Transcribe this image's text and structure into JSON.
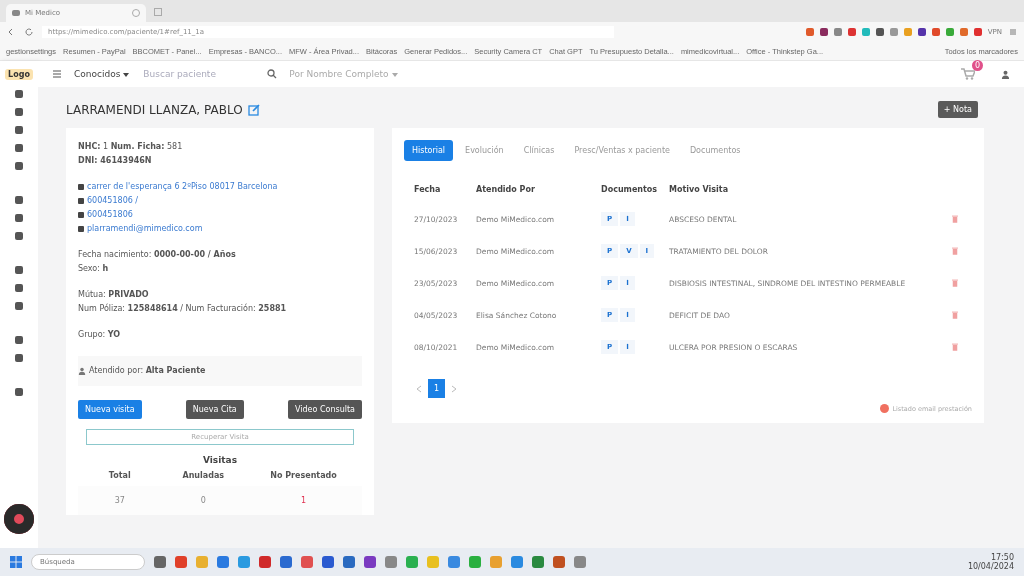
{
  "browser": {
    "tab_title": "Mi Medico",
    "url": "https://mimedico.com/paciente/1#ref_11_1a",
    "vpn": "VPN",
    "bookmarks": [
      "gestionsettings",
      "Resumen - PayPal",
      "BBCOMET - Panel...",
      "Empresas - BANCO...",
      "MFW - Área Privad...",
      "Bitácoras",
      "Generar Pedidos...",
      "Security Camera CT",
      "Chat GPT",
      "Tu Presupuesto Detalla...",
      "mimedicovirtual...",
      "Office - Thinkstep Ga..."
    ],
    "bookmarks_folder": "Todos los marcadores"
  },
  "topbar": {
    "logo": "Logo",
    "filter": "Conocidos",
    "search": {
      "placeholder": "Buscar paciente"
    },
    "search_mode": "Por Nombre Completo",
    "cart_count": "0"
  },
  "patient": {
    "name": "LARRAMENDI LLANZA, PABLO",
    "note_button": "+ Nota"
  },
  "info": {
    "lines": [
      {
        "kind": "text",
        "text": "**NHC:** 1  **Num. Ficha:** 581"
      },
      {
        "kind": "text",
        "text": "**DNI: 46143946N**"
      },
      {
        "kind": "gap"
      },
      {
        "kind": "link",
        "text": "carrer de l'esperança 6 2ºPiso 08017 Barcelona"
      },
      {
        "kind": "link",
        "text": "600451806 /"
      },
      {
        "kind": "link",
        "text": "600451806"
      },
      {
        "kind": "link",
        "text": "plarramendi@mimedico.com"
      },
      {
        "kind": "gap"
      },
      {
        "kind": "text",
        "text": "Fecha nacimiento: **0000-00-00 / Años**"
      },
      {
        "kind": "text",
        "text": "Sexo: **h**"
      },
      {
        "kind": "gap"
      },
      {
        "kind": "text",
        "text": "Mútua: **PRIVADO**"
      },
      {
        "kind": "text",
        "text": "Num Póliza: **125848614** / Num Facturación: **25881**"
      },
      {
        "kind": "gap"
      },
      {
        "kind": "text",
        "text": "Grupo: **YO**"
      }
    ],
    "attended": "Atendido por: **Alta Paciente**",
    "buttons": [
      {
        "label": "Nueva visita",
        "kind": "primary"
      },
      {
        "label": "Nueva Cita",
        "kind": "dark"
      },
      {
        "label": "Video Consulta",
        "kind": "dark"
      }
    ],
    "recover_button": "Recuperar Visita",
    "visits": {
      "title": "Visitas",
      "columns": [
        "Total",
        "Anuladas",
        "No Presentado"
      ],
      "values": [
        "37",
        "0",
        "1"
      ]
    }
  },
  "history": {
    "tabs": [
      {
        "label": "Historial",
        "selected": true
      },
      {
        "label": "Evolución",
        "selected": false
      },
      {
        "label": "Clínicas",
        "selected": false
      },
      {
        "label": "Presc/Ventas x paciente",
        "selected": false
      },
      {
        "label": "Documentos",
        "selected": false
      }
    ],
    "columns": [
      "Fecha",
      "Atendido Por",
      "Documentos",
      "Motivo Visita"
    ],
    "rows": [
      {
        "date": "27/10/2023",
        "by": "Demo MiMedico.com",
        "docs": [
          "P",
          "I"
        ],
        "reason": "ABSCESO DENTAL"
      },
      {
        "date": "15/06/2023",
        "by": "Demo MiMedico.com",
        "docs": [
          "P",
          "V",
          "I"
        ],
        "reason": "TRATAMIENTO DEL DOLOR"
      },
      {
        "date": "23/05/2023",
        "by": "Demo MiMedico.com",
        "docs": [
          "P",
          "I"
        ],
        "reason": "DISBIOSIS INTESTINAL, SINDROME DEL INTESTINO PERMEABLE"
      },
      {
        "date": "04/05/2023",
        "by": "Elisa Sánchez Cotono",
        "docs": [
          "P",
          "I"
        ],
        "reason": "DEFICIT DE DAO"
      },
      {
        "date": "08/10/2021",
        "by": "Demo MiMedico.com",
        "docs": [
          "P",
          "I"
        ],
        "reason": "ULCERA POR PRESION O ESCARAS"
      }
    ],
    "pages": [
      {
        "label": "1",
        "selected": true
      }
    ],
    "legend": "Listado email prestación"
  },
  "taskbar": {
    "search": {
      "placeholder": "Búsqueda"
    },
    "time": "17:50",
    "date": "10/04/2024"
  }
}
